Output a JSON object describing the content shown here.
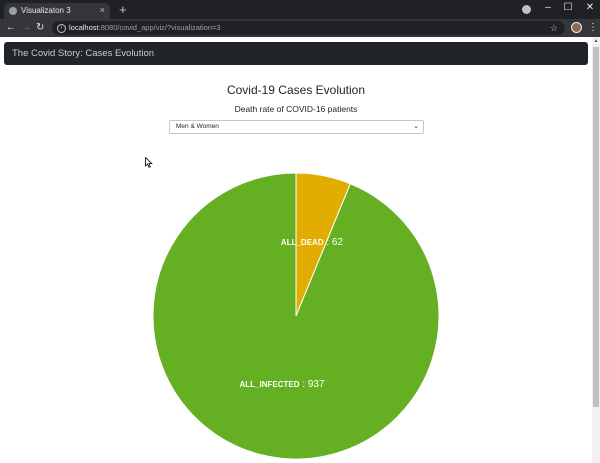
{
  "browser": {
    "tab_title": "Visualizaton 3",
    "tab_close": "×",
    "new_tab": "+",
    "url_host": "localhost",
    "url_rest": ":8080/covid_app/viz/?visualization=3",
    "window_minimize": "–",
    "window_maximize": "☐",
    "window_close": "✕",
    "back": "←",
    "forward": "→",
    "reload": "↻",
    "star": "☆",
    "menu": "⋮"
  },
  "navbar": {
    "brand": "The Covid Story: Cases Evolution"
  },
  "main": {
    "title": "Covid-19 Cases Evolution",
    "subtitle": "Death rate of COVID-16 patients",
    "select_value": "Men & Women",
    "select_chevron": "⌄"
  },
  "chart_data": {
    "type": "pie",
    "categories": [
      "ALL_DEAD",
      "ALL_INFECTED"
    ],
    "values": [
      62,
      937
    ],
    "labels": [
      "ALL_DEAD : 62",
      "ALL_INFECTED : 937"
    ],
    "colors": [
      "#e1ad01",
      "#64b022"
    ]
  }
}
